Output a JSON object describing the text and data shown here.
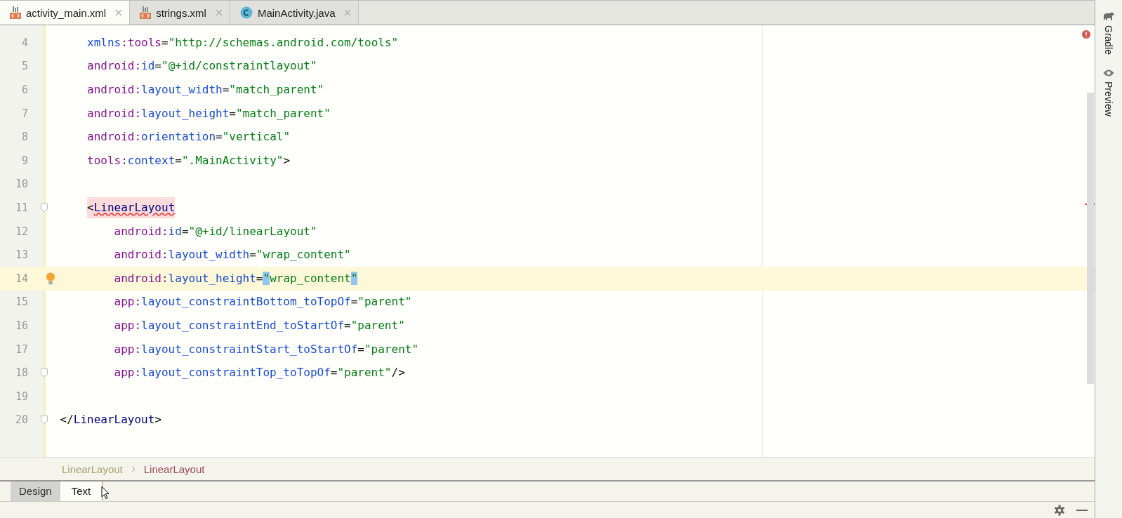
{
  "editor_tabs": [
    {
      "label": "activity_main.xml",
      "selected": true
    },
    {
      "label": "strings.xml",
      "selected": false
    },
    {
      "label": "MainActivity.java",
      "selected": false
    }
  ],
  "code": [
    {
      "children": [
        {
          "number": "4",
          "current": false,
          "fold": false,
          "segments": [
            {
              "kind": "attr",
              "text": "xmlns"
            },
            {
              "kind": "ns",
              "text": ":tools"
            },
            {
              "kind": "punct",
              "text": "="
            },
            {
              "kind": "value",
              "text": "\"http://schemas.android.com/tools\""
            }
          ]
        },
        {
          "number": "5",
          "current": false,
          "fold": false,
          "segments": [
            {
              "kind": "ns",
              "text": "android:"
            },
            {
              "kind": "attr",
              "text": "id"
            },
            {
              "kind": "punct",
              "text": "="
            },
            {
              "kind": "value",
              "text": "\"@+id/constraintlayout\""
            }
          ]
        },
        {
          "number": "6",
          "current": false,
          "fold": false,
          "segments": [
            {
              "kind": "ns",
              "text": "android:"
            },
            {
              "kind": "attr",
              "text": "layout_width"
            },
            {
              "kind": "punct",
              "text": "="
            },
            {
              "kind": "value",
              "text": "\"match_parent\""
            }
          ]
        },
        {
          "number": "7",
          "current": false,
          "fold": false,
          "segments": [
            {
              "kind": "ns",
              "text": "android:"
            },
            {
              "kind": "attr",
              "text": "layout_height"
            },
            {
              "kind": "punct",
              "text": "="
            },
            {
              "kind": "value",
              "text": "\"match_parent\""
            }
          ]
        },
        {
          "number": "8",
          "current": false,
          "fold": false,
          "segments": [
            {
              "kind": "ns",
              "text": "android:"
            },
            {
              "kind": "attr",
              "text": "orientation"
            },
            {
              "kind": "punct",
              "text": "="
            },
            {
              "kind": "value",
              "text": "\"vertical\""
            }
          ]
        },
        {
          "number": "9",
          "current": false,
          "fold": false,
          "segments": [
            {
              "kind": "ns",
              "text": "tools:"
            },
            {
              "kind": "attr",
              "text": "context"
            },
            {
              "kind": "punct",
              "text": "="
            },
            {
              "kind": "value",
              "text": "\".MainActivity\""
            },
            {
              "kind": "punct",
              "text": ">"
            }
          ]
        },
        {
          "number": "10",
          "current": false,
          "fold": false
        },
        {
          "number": "11",
          "current": false,
          "fold": true,
          "error": true,
          "segments": [
            {
              "kind": "punct",
              "text": "<"
            },
            {
              "kind": "tag",
              "text": "LinearLayout"
            }
          ],
          "children": [
            {
              "number": "12",
              "current": false,
              "fold": false,
              "segments": [
                {
                  "kind": "ns",
                  "text": "android:"
                },
                {
                  "kind": "attr",
                  "text": "id"
                },
                {
                  "kind": "punct",
                  "text": "="
                },
                {
                  "kind": "value",
                  "text": "\"@+id/linearLayout\""
                }
              ]
            },
            {
              "number": "13",
              "current": false,
              "fold": false,
              "segments": [
                {
                  "kind": "ns",
                  "text": "android:"
                },
                {
                  "kind": "attr",
                  "text": "layout_width"
                },
                {
                  "kind": "punct",
                  "text": "="
                },
                {
                  "kind": "value",
                  "text": "\"wrap_content\""
                }
              ]
            },
            {
              "number": "14",
              "current": true,
              "fold": false,
              "segments": [
                {
                  "kind": "ns",
                  "text": "android:"
                },
                {
                  "kind": "attr",
                  "text": "layout_height"
                },
                {
                  "kind": "punct",
                  "text": "="
                },
                {
                  "kind": "brace",
                  "text": "\""
                },
                {
                  "kind": "value",
                  "text": "wrap_content"
                },
                {
                  "kind": "brace",
                  "text": "\""
                }
              ]
            },
            {
              "number": "15",
              "current": false,
              "fold": false,
              "segments": [
                {
                  "kind": "ns",
                  "text": "app:"
                },
                {
                  "kind": "attr",
                  "text": "layout_constraintBottom_toTopOf"
                },
                {
                  "kind": "punct",
                  "text": "="
                },
                {
                  "kind": "value",
                  "text": "\"parent\""
                }
              ]
            },
            {
              "number": "16",
              "current": false,
              "fold": false,
              "segments": [
                {
                  "kind": "ns",
                  "text": "app:"
                },
                {
                  "kind": "attr",
                  "text": "layout_constraintEnd_toStartOf"
                },
                {
                  "kind": "punct",
                  "text": "="
                },
                {
                  "kind": "value",
                  "text": "\"parent\""
                }
              ]
            },
            {
              "number": "17",
              "current": false,
              "fold": false,
              "segments": [
                {
                  "kind": "ns",
                  "text": "app:"
                },
                {
                  "kind": "attr",
                  "text": "layout_constraintStart_toStartOf"
                },
                {
                  "kind": "punct",
                  "text": "="
                },
                {
                  "kind": "value",
                  "text": "\"parent\""
                }
              ]
            },
            {
              "number": "18",
              "current": false,
              "fold": true,
              "segments": [
                {
                  "kind": "ns",
                  "text": "app:"
                },
                {
                  "kind": "attr",
                  "text": "layout_constraintTop_toTopOf"
                },
                {
                  "kind": "punct",
                  "text": "="
                },
                {
                  "kind": "value",
                  "text": "\"parent\""
                },
                {
                  "kind": "punct",
                  "text": "/>"
                }
              ]
            }
          ]
        },
        {
          "number": "19",
          "current": false,
          "fold": false
        }
      ]
    },
    {
      "number": "20",
      "current": false,
      "fold": true,
      "segments": [
        {
          "kind": "punct",
          "text": "</"
        },
        {
          "kind": "tag",
          "text": "LinearLayout"
        },
        {
          "kind": "punct",
          "text": ">"
        }
      ]
    }
  ],
  "breadcrumbs": [
    {
      "label": "LinearLayout",
      "selected": false
    },
    {
      "label": "LinearLayout",
      "selected": true
    }
  ],
  "bottom_tabs": [
    {
      "label": "Design",
      "selected": false
    },
    {
      "label": "Text",
      "selected": true
    }
  ],
  "side_tools": [
    {
      "label": "Gradle"
    },
    {
      "label": "Preview"
    }
  ]
}
